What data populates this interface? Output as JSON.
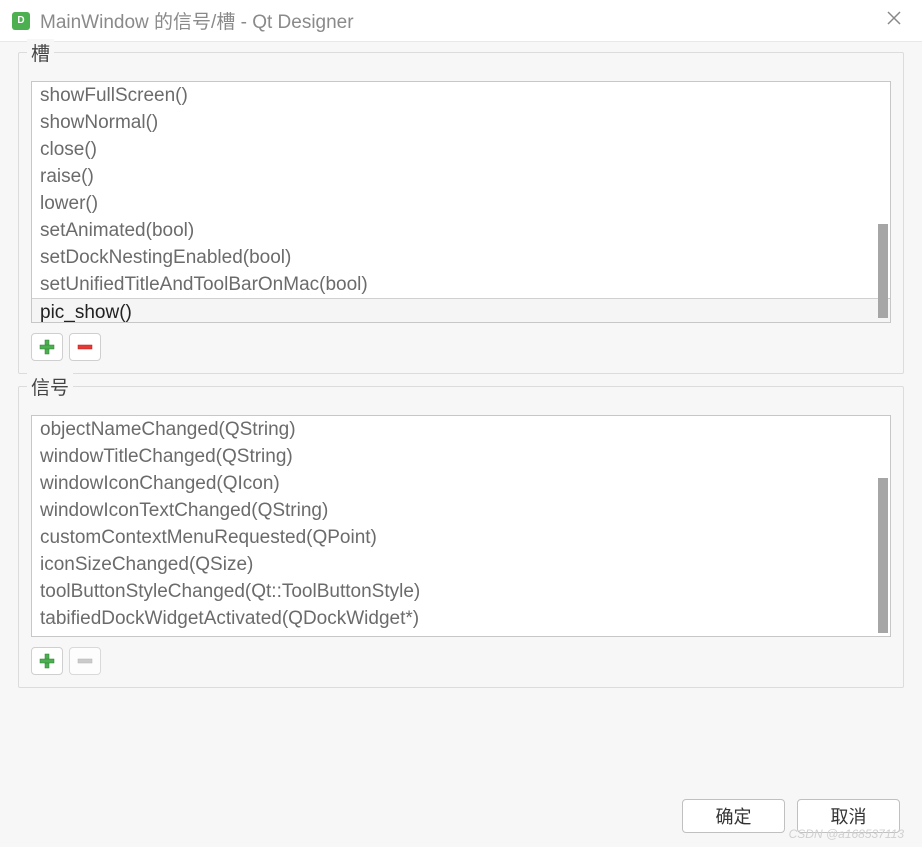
{
  "window": {
    "app_icon_text": "D",
    "title": "MainWindow 的信号/槽 - Qt Designer"
  },
  "slots": {
    "label": "槽",
    "items": [
      "showFullScreen()",
      "showNormal()",
      "close()",
      "raise()",
      "lower()",
      "setAnimated(bool)",
      "setDockNestingEnabled(bool)",
      "setUnifiedTitleAndToolBarOnMac(bool)",
      "pic_show()"
    ],
    "editable_index": 8
  },
  "signals": {
    "label": "信号",
    "items": [
      "objectNameChanged(QString)",
      "windowTitleChanged(QString)",
      "windowIconChanged(QIcon)",
      "windowIconTextChanged(QString)",
      "customContextMenuRequested(QPoint)",
      "iconSizeChanged(QSize)",
      "toolButtonStyleChanged(Qt::ToolButtonStyle)",
      "tabifiedDockWidgetActivated(QDockWidget*)"
    ]
  },
  "buttons": {
    "ok": "确定",
    "cancel": "取消"
  },
  "watermark": "CSDN @a168537113"
}
